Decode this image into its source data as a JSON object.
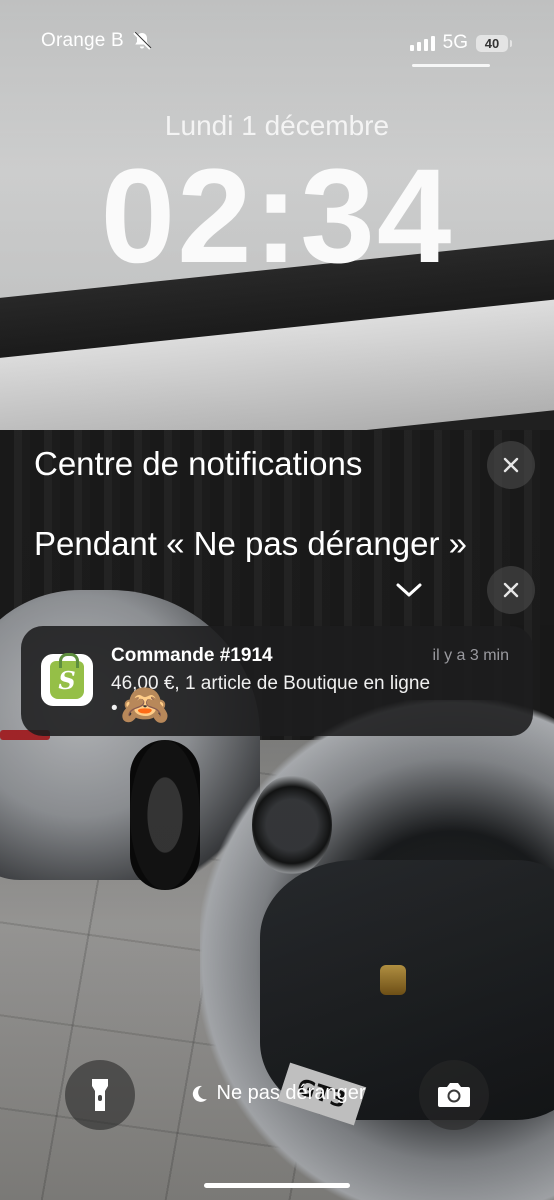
{
  "status_bar": {
    "carrier": "Orange B",
    "network": "5G",
    "battery": "40",
    "icons": [
      "bell-slash-icon",
      "signal-icon",
      "battery-icon"
    ]
  },
  "lock_screen": {
    "date": "Lundi 1 décembre",
    "time": "02:34"
  },
  "notification_center": {
    "title": "Centre de notifications",
    "subtitle": "Pendant « Ne pas déranger »",
    "icons": [
      "close-icon",
      "chevron-down-icon"
    ]
  },
  "notification": {
    "app_icon": "shopify-icon",
    "title": "Commande #1914",
    "time": "il y a 3 min",
    "body_line1": "46,00 €, 1 article de Boutique en ligne",
    "body_line2": "•",
    "emoji": "🙈"
  },
  "bottom": {
    "focus_label": "Ne pas déranger",
    "icons": [
      "flashlight-icon",
      "moon-icon",
      "camera-icon"
    ]
  },
  "colors": {
    "card_bg": "#1c1c1e",
    "shopify_green": "#95bf47",
    "secondary_text": "#9a9a9f"
  }
}
